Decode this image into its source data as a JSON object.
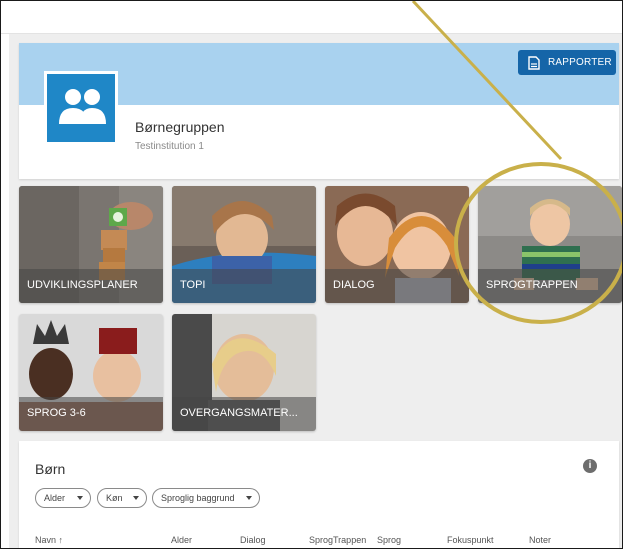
{
  "header": {
    "title": "Børnegruppen",
    "subtitle": "Testinstitution 1",
    "report_button": "RAPPORTER"
  },
  "tiles": [
    {
      "label": "UDVIKLINGSPLANER"
    },
    {
      "label": "TOPI"
    },
    {
      "label": "DIALOG"
    },
    {
      "label": "SPROGTRAPPEN"
    },
    {
      "label": "SPROG 3-6"
    },
    {
      "label": "OVERGANGSMATER..."
    }
  ],
  "children": {
    "title": "Børn",
    "filters": [
      "Alder",
      "Køn",
      "Sproglig baggrund"
    ],
    "columns": [
      "Navn ↑",
      "Alder",
      "Dialog",
      "SprogTrappen",
      "Sprog",
      "Fokuspunkt",
      "Noter"
    ]
  },
  "icons": {
    "avatar": "people-group-icon",
    "report": "document-icon",
    "info": "info-icon"
  },
  "colors": {
    "header_band": "#a9d2ef",
    "avatar_bg": "#1f87c7",
    "report_button": "#1565a8",
    "annotation": "#c9b04a"
  }
}
